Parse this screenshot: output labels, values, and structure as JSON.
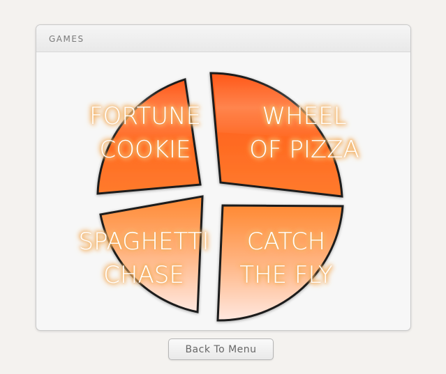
{
  "panel": {
    "title": "GAMES"
  },
  "games": [
    {
      "id": "fortune-cookie",
      "line1": "FORTUNE",
      "line2": "COOKIE"
    },
    {
      "id": "wheel-of-pizza",
      "line1": "WHEEL",
      "line2": "OF PIZZA"
    },
    {
      "id": "spaghetti-chase",
      "line1": "SPAGHETTI",
      "line2": "CHASE"
    },
    {
      "id": "catch-the-fly",
      "line1": "CATCH",
      "line2": "THE FLY"
    }
  ],
  "back_button": {
    "label": "Back To Menu"
  },
  "colors": {
    "slice_dark": "#ff5a1a",
    "slice_mid": "#ff8a34",
    "slice_light": "#ffe6dc",
    "outline": "#1c1c1c",
    "label_glow": "#f4a94f"
  }
}
